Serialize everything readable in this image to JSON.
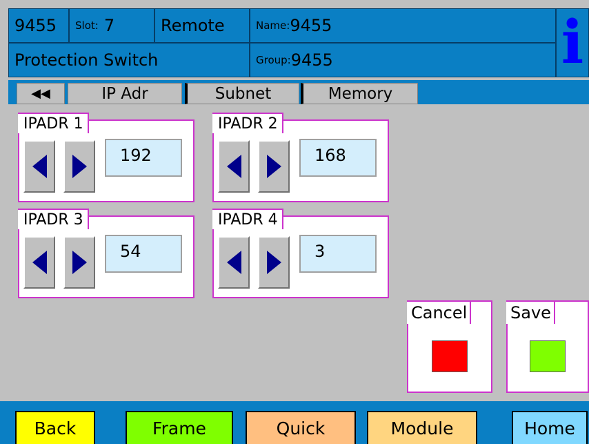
{
  "header": {
    "id": "9455",
    "slot_label": "Slot:",
    "slot_value": "7",
    "mode": "Remote",
    "name_label": "Name:",
    "name_value": "9455",
    "function": "Protection Switch",
    "group_label": "Group:",
    "group_value": "9455",
    "info_glyph": "i"
  },
  "tabs": [
    {
      "label": "◀◀"
    },
    {
      "label": "IP Adr"
    },
    {
      "label": "Subnet",
      "selected": true
    },
    {
      "label": "Memory"
    }
  ],
  "ip_groups": [
    {
      "label": "IPADR 1",
      "value": "192"
    },
    {
      "label": "IPADR 2",
      "value": "168"
    },
    {
      "label": "IPADR 3",
      "value": "54"
    },
    {
      "label": "IPADR 4",
      "value": "3"
    }
  ],
  "actions": {
    "cancel": {
      "label": "Cancel",
      "color": "#ff0000"
    },
    "save": {
      "label": "Save",
      "color": "#7fff00"
    }
  },
  "footer": [
    {
      "label": "Back",
      "color": "#ffff00"
    },
    {
      "label": "Frame",
      "color": "#7fff00"
    },
    {
      "label": "Quick",
      "color": "#ffbf80"
    },
    {
      "label": "Module",
      "color": "#ffd580"
    },
    {
      "label": "Home",
      "color": "#80d8ff"
    }
  ],
  "icons": {
    "left_arrow": "left-arrow-icon",
    "right_arrow": "right-arrow-icon",
    "info": "info-icon"
  }
}
